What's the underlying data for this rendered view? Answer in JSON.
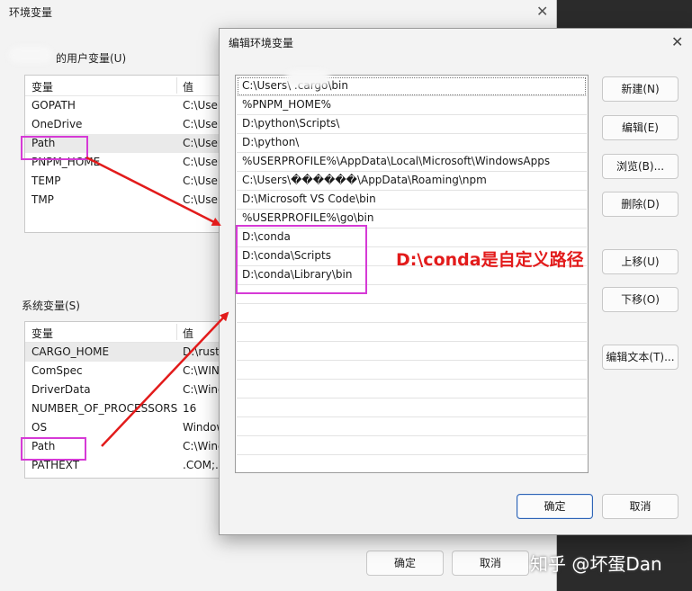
{
  "bg_dialog": {
    "title": "环境变量",
    "user_group_label": "的用户变量(U)",
    "user_vars_header": [
      "变量",
      "值"
    ],
    "user_vars": [
      {
        "name": "GOPATH",
        "value": "C:\\User"
      },
      {
        "name": "OneDrive",
        "value": "C:\\User"
      },
      {
        "name": "Path",
        "value": "C:\\User"
      },
      {
        "name": "PNPM_HOME",
        "value": "C:\\User"
      },
      {
        "name": "TEMP",
        "value": "C:\\User"
      },
      {
        "name": "TMP",
        "value": "C:\\User"
      }
    ],
    "sys_group_label": "系统变量(S)",
    "sys_vars_header": [
      "变量",
      "值"
    ],
    "sys_vars": [
      {
        "name": "CARGO_HOME",
        "value": "D:\\rust"
      },
      {
        "name": "ComSpec",
        "value": "C:\\WIN"
      },
      {
        "name": "DriverData",
        "value": "C:\\Wind"
      },
      {
        "name": "NUMBER_OF_PROCESSORS",
        "value": "16"
      },
      {
        "name": "OS",
        "value": "Window"
      },
      {
        "name": "Path",
        "value": "C:\\Wind"
      },
      {
        "name": "PATHEXT",
        "value": ".COM;."
      }
    ],
    "ok_label": "确定",
    "cancel_label": "取消"
  },
  "fg_dialog": {
    "title": "编辑环境变量",
    "paths": [
      "C:\\Users\\        .cargo\\bin",
      "%PNPM_HOME%",
      "D:\\python\\Scripts\\",
      "D:\\python\\",
      "%USERPROFILE%\\AppData\\Local\\Microsoft\\WindowsApps",
      "C:\\Users\\������\\AppData\\Roaming\\npm",
      "D:\\Microsoft VS Code\\bin",
      "%USERPROFILE%\\go\\bin",
      "D:\\conda",
      "D:\\conda\\Scripts",
      "D:\\conda\\Library\\bin"
    ],
    "buttons": {
      "new": "新建(N)",
      "edit": "编辑(E)",
      "browse": "浏览(B)...",
      "delete": "删除(D)",
      "move_up": "上移(U)",
      "move_down": "下移(O)",
      "edit_text": "编辑文本(T)..."
    },
    "ok_label": "确定",
    "cancel_label": "取消"
  },
  "annotation": "D:\\conda是自定义路径",
  "watermark": "知乎 @坏蛋Dan",
  "colors": {
    "highlight_box": "#d63ad6",
    "arrow": "#e21b1b",
    "annotation": "#e21b1b"
  }
}
